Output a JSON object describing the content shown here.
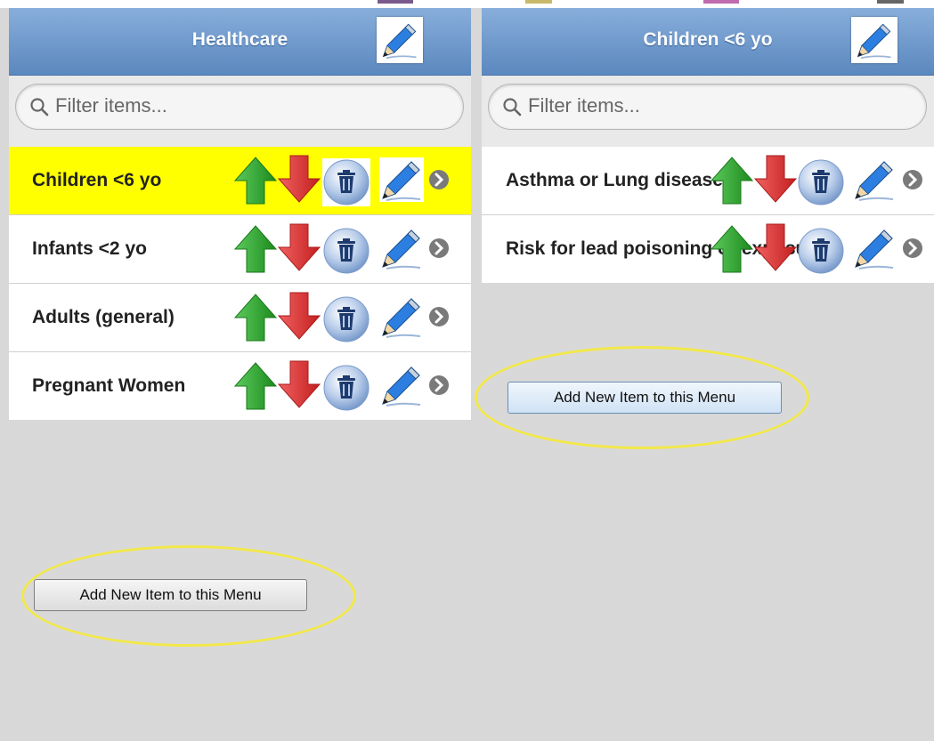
{
  "colors": {
    "header_top": "#88aedb",
    "header_bottom": "#5b88bf",
    "selected_row": "#ffff00",
    "page_background": "#d8d8d8",
    "up_arrow": "#2e9e2e",
    "down_arrow": "#d83030",
    "annotation_ellipse": "#f2e84a"
  },
  "left_panel": {
    "title": "Healthcare",
    "edit_icon": "pencil-icon",
    "search": {
      "placeholder": "Filter items...",
      "value": ""
    },
    "items": [
      {
        "label": "Children <6 yo",
        "selected": true
      },
      {
        "label": "Infants <2 yo",
        "selected": false
      },
      {
        "label": "Adults (general)",
        "selected": false
      },
      {
        "label": "Pregnant Women",
        "selected": false
      }
    ],
    "add_button": "Add New Item to this Menu"
  },
  "right_panel": {
    "title": "Children <6 yo",
    "edit_icon": "pencil-icon",
    "search": {
      "placeholder": "Filter items...",
      "value": ""
    },
    "items": [
      {
        "label": "Asthma or Lung disease",
        "selected": false
      },
      {
        "label": "Risk for lead poisoning or exposure",
        "selected": false
      }
    ],
    "add_button": "Add New Item to this Menu"
  },
  "row_icons": [
    "up-arrow-icon",
    "down-arrow-icon",
    "trash-icon",
    "pencil-icon",
    "chevron-right-icon"
  ]
}
